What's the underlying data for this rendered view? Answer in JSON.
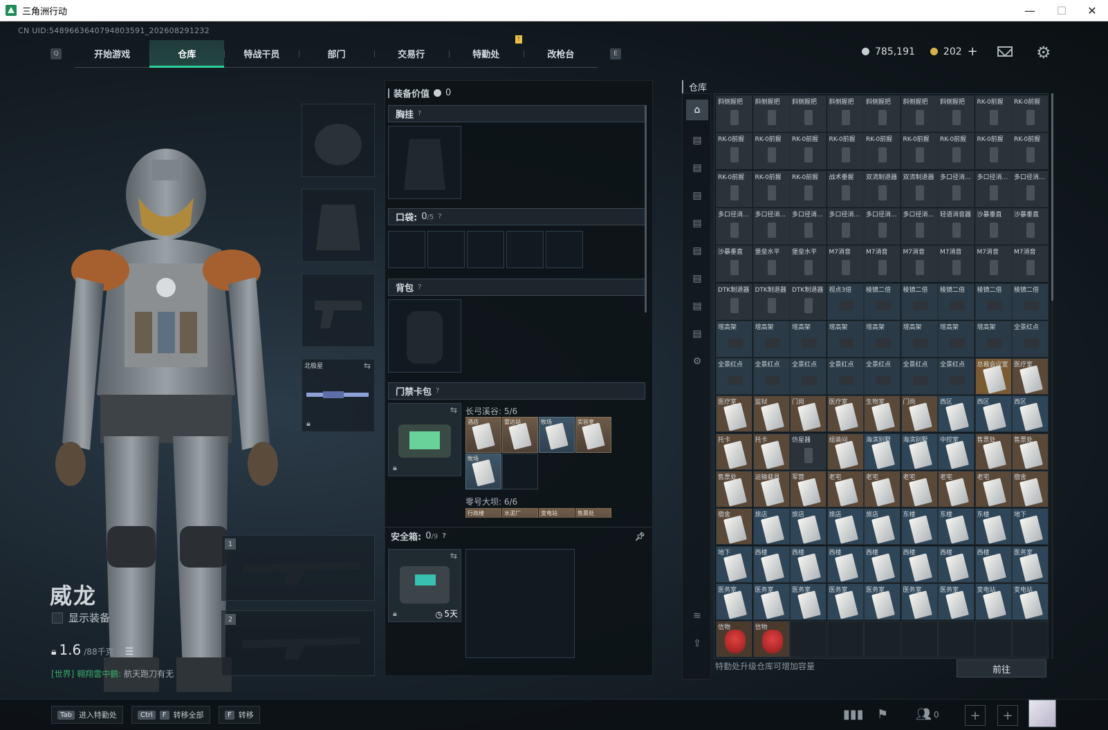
{
  "window": {
    "title": "三角洲行动"
  },
  "uid": "CN UID:5489663640794803591_202608291232",
  "nav": {
    "left_key": "Q",
    "right_key": "E",
    "tabs": [
      {
        "label": "开始游戏",
        "active": false
      },
      {
        "label": "仓库",
        "active": true
      },
      {
        "label": "特战干员",
        "active": false
      },
      {
        "label": "部门",
        "active": false
      },
      {
        "label": "交易行",
        "active": false
      },
      {
        "label": "特勤处",
        "active": false
      },
      {
        "label": "改枪台",
        "active": false
      }
    ]
  },
  "currency": {
    "silver": "785,191",
    "gold": "202",
    "gold_plus": "+",
    "silver_color": "#c9ced2",
    "gold_color": "#d6b24a"
  },
  "operator": {
    "name": "威龙",
    "show_equipment": "显示装备",
    "weight": "1.6",
    "weight_max": "/88千克",
    "chat_channel": "[世界]",
    "chat_user": "翱翔雲中鶴:",
    "chat_text": "航天跑刀有无"
  },
  "equip_slots": [
    {
      "name": "helmet"
    },
    {
      "name": "armor"
    },
    {
      "name": "pistol"
    },
    {
      "name": "melee",
      "label": "北极星"
    }
  ],
  "weapon_slots": [
    {
      "num": "1"
    },
    {
      "num": "2"
    }
  ],
  "mid": {
    "equip_value_label": "装备价值",
    "equip_value": "0",
    "chest_rig": "胸挂",
    "pockets": "口袋:",
    "pockets_count": "0",
    "pockets_max": "/5",
    "backpack": "背包",
    "keycard_bag": "门禁卡包",
    "map1": "长弓溪谷: 5/6",
    "map1_cards": [
      "酒店",
      "雷达站",
      "牧场",
      "实验室",
      "牧场"
    ],
    "map2": "零号大坝: 6/6",
    "map2_cards": [
      "行政楼",
      "水泥厂",
      "变电站",
      "售票处"
    ],
    "safe_box": "安全箱:",
    "safe_count": "0",
    "safe_max": "/9",
    "safe_timer": "5天"
  },
  "warehouse": {
    "title": "仓库",
    "footer": "特勤处升级仓库可增加容量",
    "goto": "前往",
    "side_icons": [
      "home-icon",
      "storage-1-icon",
      "storage-2-icon",
      "storage-3-icon",
      "storage-4-icon",
      "storage-5-icon",
      "storage-6-icon",
      "storage-7-icon",
      "storage-8-icon",
      "settings-icon",
      "layers-icon",
      "upload-icon"
    ],
    "rows": [
      [
        "斜侧握把",
        "斜侧握把",
        "斜侧握把",
        "斜侧握把",
        "斜侧握把",
        "斜侧握把",
        "斜侧握把",
        "RK-0前握",
        "RK-0前握"
      ],
      [
        "RK-0前握",
        "RK-0前握",
        "RK-0前握",
        "RK-0前握",
        "RK-0前握",
        "RK-0前握",
        "RK-0前握",
        "RK-0前握",
        "RK-0前握"
      ],
      [
        "RK-0前握",
        "RK-0前握",
        "RK-0前握",
        "战术垂握",
        "双流制退器",
        "双流制退器",
        "多口径消...",
        "多口径消...",
        "多口径消..."
      ],
      [
        "多口径消...",
        "多口径消...",
        "多口径消...",
        "多口径消...",
        "多口径消...",
        "多口径消...",
        "轻语消音器",
        "沙暴垂直",
        "沙暴垂直"
      ],
      [
        "沙暴垂直",
        "堡垒水平",
        "堡垒水平",
        "M7消音",
        "M7消音",
        "M7消音",
        "M7消音",
        "M7消音",
        "M7消音"
      ],
      [
        "DTK制退器",
        "DTK制退器",
        "DTK制退器",
        "视点3倍",
        "棱镜二倍",
        "棱镜二倍",
        "棱镜二倍",
        "棱镜二倍",
        "棱镜二倍"
      ],
      [
        "增高架",
        "增高架",
        "增高架",
        "增高架",
        "增高架",
        "增高架",
        "增高架",
        "增高架",
        "全景红点"
      ],
      [
        "全景红点",
        "全景红点",
        "全景红点",
        "全景红点",
        "全景红点",
        "全景红点",
        "全景红点",
        "总裁会议室",
        "医疗室"
      ],
      [
        "医疗室",
        "监狱",
        "门岗",
        "医疗室",
        "生物室",
        "门岗",
        "西区",
        "西区",
        "西区"
      ],
      [
        "托卡",
        "托卡",
        "仿星器",
        "组装间",
        "海滨别墅",
        "海滨别墅",
        "中控室",
        "售票处",
        "售票处"
      ],
      [
        "售票处",
        "运输载具",
        "军营",
        "老宅",
        "老宅",
        "老宅",
        "老宅",
        "老宅",
        "宿舍"
      ],
      [
        "宿舍",
        "旅店",
        "旅店",
        "旅店",
        "旅店",
        "东楼",
        "东楼",
        "东楼",
        "地下"
      ],
      [
        "地下",
        "西楼",
        "西楼",
        "西楼",
        "西楼",
        "西楼",
        "西楼",
        "西楼",
        "医务室"
      ],
      [
        "医务室",
        "医务室",
        "医务室",
        "医务室",
        "医务室",
        "医务室",
        "医务室",
        "变电站",
        "变电站"
      ],
      [
        "信物",
        "信物",
        "",
        "",
        "",
        "",
        "",
        "",
        ""
      ]
    ]
  },
  "bottom": {
    "hotkeys": [
      {
        "keys": [
          "Tab"
        ],
        "label": "进入特勤处"
      },
      {
        "keys": [
          "Ctrl",
          "F"
        ],
        "label": "转移全部"
      },
      {
        "keys": [
          "F"
        ],
        "label": "转移"
      }
    ],
    "friends_count": "0"
  }
}
